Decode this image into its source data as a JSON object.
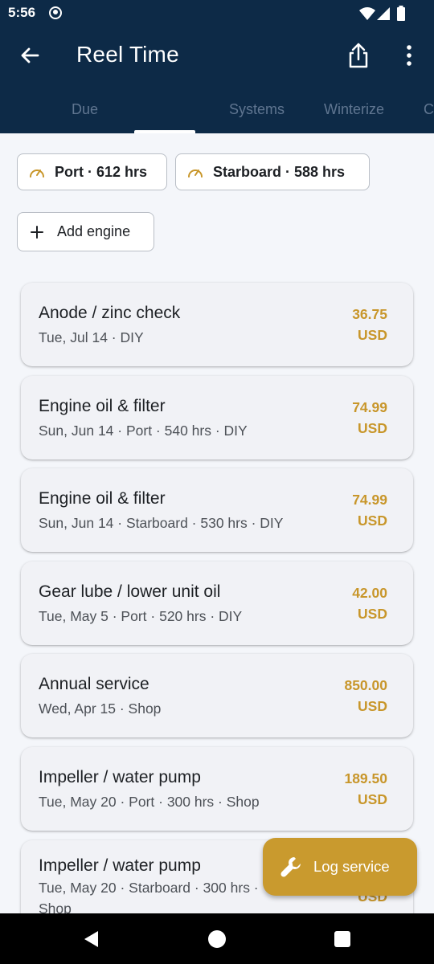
{
  "status_bar": {
    "time": "5:56"
  },
  "app_bar": {
    "title": "Reel Time",
    "tabs": [
      "Due",
      "Systems",
      "Winterize",
      "C"
    ]
  },
  "engines": [
    {
      "label": "Port · 612 hrs",
      "icon": "speedometer-icon"
    },
    {
      "label": "Starboard · 588 hrs",
      "icon": "speedometer-icon"
    }
  ],
  "add_engine_label": "Add engine",
  "services": [
    {
      "name": "Anode / zinc check",
      "meta": "Tue, Jul 14 · DIY",
      "amount": "36.75",
      "currency": "USD"
    },
    {
      "name": "Engine oil & filter",
      "meta": "Sun, Jun 14 · Port · 540 hrs · DIY",
      "amount": "74.99",
      "currency": "USD"
    },
    {
      "name": "Engine oil & filter",
      "meta": "Sun, Jun 14 · Starboard · 530 hrs · DIY",
      "amount": "74.99",
      "currency": "USD"
    },
    {
      "name": "Gear lube / lower unit oil",
      "meta": "Tue, May 5 · Port · 520 hrs · DIY",
      "amount": "42.00",
      "currency": "USD"
    },
    {
      "name": "Annual service",
      "meta": "Wed, Apr 15 · Shop",
      "amount": "850.00",
      "currency": "USD"
    },
    {
      "name": "Impeller / water pump",
      "meta": "Tue, May 20 · Port · 300 hrs · Shop",
      "amount": "189.50",
      "currency": "USD"
    },
    {
      "name": "Impeller / water pump",
      "meta": "Tue, May 20 · Starboard · 300 hrs ·",
      "meta2": "Shop",
      "currency": "USD"
    }
  ],
  "fab": {
    "label": "Log service",
    "icon": "wrench-icon"
  },
  "colors": {
    "primary": "#0d2a47",
    "accent": "#c99a2e",
    "amount": "#c8962a"
  }
}
